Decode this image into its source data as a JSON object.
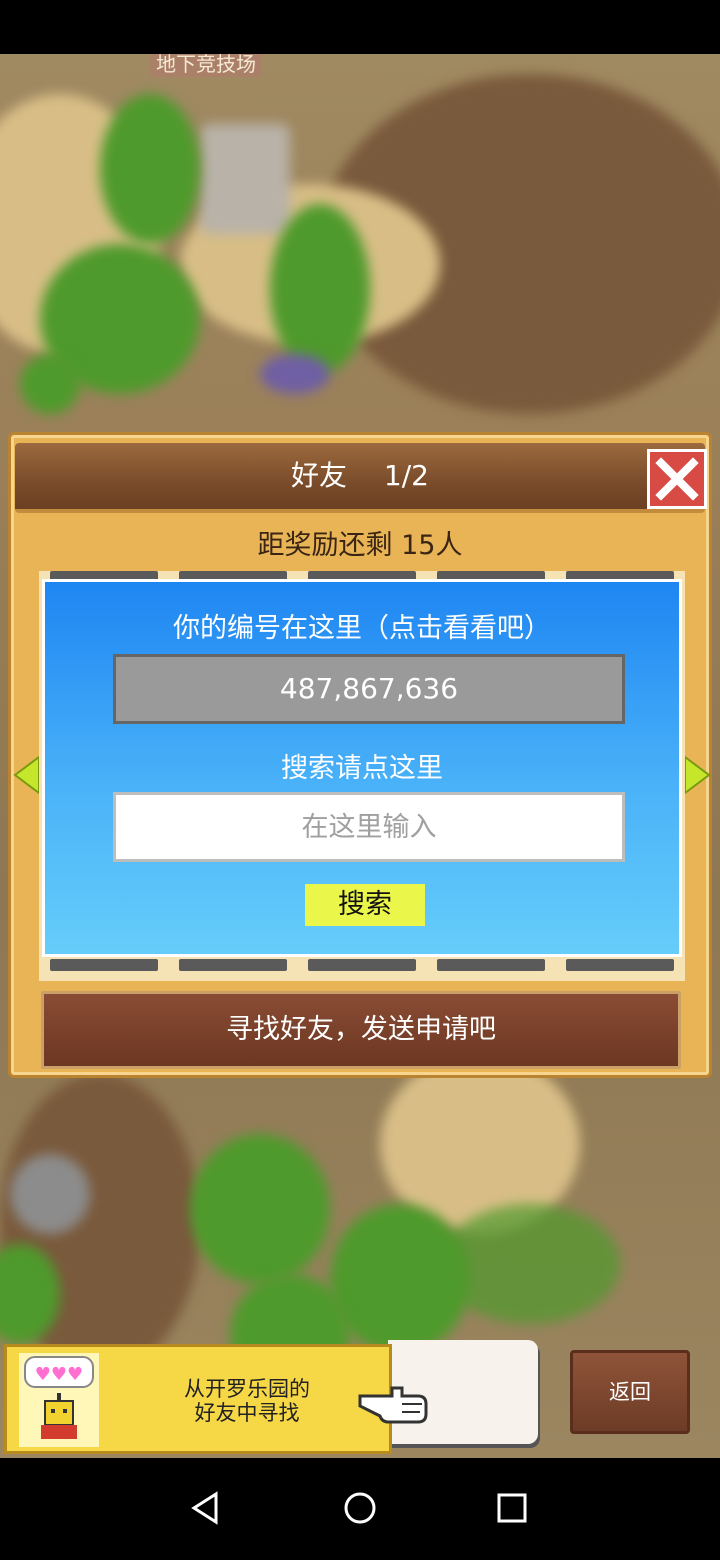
{
  "background": {
    "building_label": "地下竞技场"
  },
  "dialog": {
    "title": "好友　 1/2",
    "reward_text": "距奖励还剩 15人",
    "id_heading": "你的编号在这里（点击看看吧）",
    "id_value": "487,867,636",
    "search_heading": "搜索请点这里",
    "search_placeholder": "在这里输入",
    "search_button": "搜索",
    "find_friends_button": "寻找好友，发送申请吧"
  },
  "promo": {
    "text_line1": "从开罗乐园的",
    "text_line2": "好友中寻找"
  },
  "back_button": "返回",
  "colors": {
    "dialog_bg": "#e8b455",
    "close_red": "#d84a44",
    "panel_blue": "#1e86f2",
    "search_button_yellow": "#eaf64a",
    "find_bar_brown": "#7a3f27"
  },
  "icons": {
    "close": "close-x-icon",
    "left": "arrow-left-icon",
    "right": "arrow-right-icon",
    "hand": "pointing-hand-icon",
    "nav_back": "triangle-back-icon",
    "nav_home": "circle-home-icon",
    "nav_recent": "square-recent-icon"
  }
}
